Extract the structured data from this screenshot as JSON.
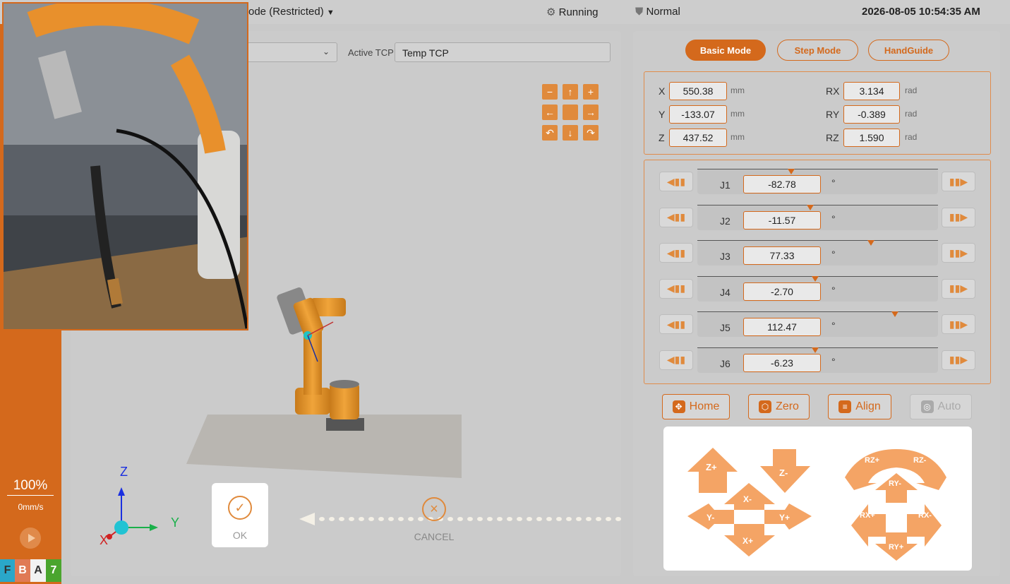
{
  "topbar": {
    "mode_text": "ode (Restricted)",
    "status_running": "Running",
    "status_safety": "Normal",
    "datetime": "2026-08-05 10:54:35 AM"
  },
  "tcp": {
    "label": "Active TCP",
    "value": "Temp TCP"
  },
  "left": {
    "speed_percent": "100%",
    "speed_mmps": "0mm/s",
    "tiles": [
      {
        "label": "F",
        "color": "#2aa7c9"
      },
      {
        "label": "B",
        "color": "#e07a55"
      },
      {
        "label": "A",
        "color": "#f2f2f2"
      },
      {
        "label": "7",
        "color": "#4aa52e"
      }
    ]
  },
  "dialog": {
    "ok_label": "OK",
    "cancel_label": "CANCEL"
  },
  "axes": {
    "z": "Z",
    "y": "Y",
    "x": "X"
  },
  "modes": [
    "Basic Mode",
    "Step Mode",
    "HandGuide"
  ],
  "pose": {
    "x": {
      "label": "X",
      "value": "550.38",
      "unit": "mm"
    },
    "y": {
      "label": "Y",
      "value": "-133.07",
      "unit": "mm"
    },
    "z": {
      "label": "Z",
      "value": "437.52",
      "unit": "mm"
    },
    "rx": {
      "label": "RX",
      "value": "3.134",
      "unit": "rad"
    },
    "ry": {
      "label": "RY",
      "value": "-0.389",
      "unit": "rad"
    },
    "rz": {
      "label": "RZ",
      "value": "1.590",
      "unit": "rad"
    }
  },
  "joints": [
    {
      "label": "J1",
      "value": "-82.78",
      "unit": "°",
      "marker": 0.39
    },
    {
      "label": "J2",
      "value": "-11.57",
      "unit": "°",
      "marker": 0.47
    },
    {
      "label": "J3",
      "value": "77.33",
      "unit": "°",
      "marker": 0.72
    },
    {
      "label": "J4",
      "value": "-2.70",
      "unit": "°",
      "marker": 0.49
    },
    {
      "label": "J5",
      "value": "112.47",
      "unit": "°",
      "marker": 0.82
    },
    {
      "label": "J6",
      "value": "-6.23",
      "unit": "°",
      "marker": 0.49
    }
  ],
  "actions": {
    "home": "Home",
    "zero": "Zero",
    "align": "Align",
    "auto": "Auto"
  },
  "jog": {
    "zplus": "Z+",
    "zminus": "Z-",
    "xminus": "X-",
    "xplus": "X+",
    "yminus": "Y-",
    "yplus": "Y+",
    "rzplus": "RZ+",
    "rzminus": "RZ-",
    "ryminus": "RY-",
    "ryplus": "RY+",
    "rxplus": "RX+",
    "rxminus": "RX-"
  },
  "colors": {
    "accent": "#d4691c",
    "arrow": "#f4a465"
  }
}
